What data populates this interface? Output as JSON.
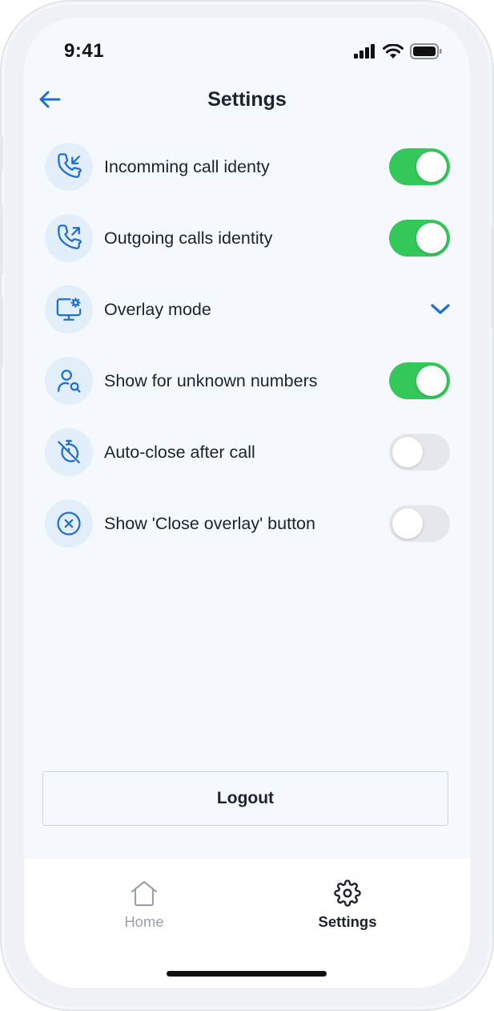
{
  "status_bar": {
    "time": "9:41"
  },
  "header": {
    "title": "Settings"
  },
  "settings": [
    {
      "label": "Incomming call identy",
      "icon": "incoming-call-icon",
      "control": "toggle",
      "enabled": true
    },
    {
      "label": "Outgoing calls identity",
      "icon": "outgoing-call-icon",
      "control": "toggle",
      "enabled": true
    },
    {
      "label": "Overlay mode",
      "icon": "monitor-settings-icon",
      "control": "dropdown"
    },
    {
      "label": "Show for unknown numbers",
      "icon": "user-search-icon",
      "control": "toggle",
      "enabled": true
    },
    {
      "label": "Auto-close after call",
      "icon": "timer-off-icon",
      "control": "toggle",
      "enabled": false
    },
    {
      "label": "Show 'Close overlay' button",
      "icon": "close-circle-icon",
      "control": "toggle",
      "enabled": false
    }
  ],
  "logout": {
    "label": "Logout"
  },
  "tabbar": {
    "tabs": [
      {
        "label": "Home",
        "icon": "home-icon",
        "active": false
      },
      {
        "label": "Settings",
        "icon": "gear-icon",
        "active": true
      }
    ]
  },
  "colors": {
    "accent": "#1f6fd1",
    "toggle_on": "#34c759",
    "toggle_off": "#e5e7ec",
    "icon_bg": "#e3eefb",
    "screen_bg": "#f5f8fc"
  }
}
